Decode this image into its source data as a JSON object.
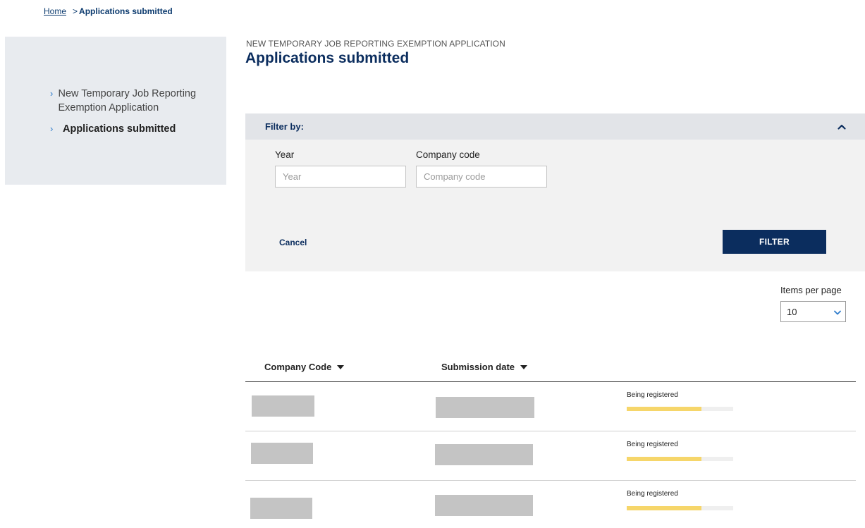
{
  "breadcrumb": {
    "home": "Home",
    "separator": ">",
    "current": "Applications submitted"
  },
  "sidebar": {
    "items": [
      {
        "label": "New Temporary Job Reporting Exemption Application",
        "chevron": "›",
        "active": false
      },
      {
        "label": "Applications submitted",
        "chevron": "›",
        "active": true
      }
    ]
  },
  "page": {
    "eyebrow": "NEW TEMPORARY JOB REPORTING EXEMPTION APPLICATION",
    "title": "Applications submitted"
  },
  "filter": {
    "title": "Filter by:",
    "toggle_icon": "chevron-up-icon",
    "fields": [
      {
        "label": "Year",
        "placeholder": "Year",
        "value": ""
      },
      {
        "label": "Company code",
        "placeholder": "Company code",
        "value": ""
      }
    ],
    "cancel_label": "Cancel",
    "submit_label": "FILTER"
  },
  "pagination": {
    "label": "Items per page",
    "value": "10"
  },
  "table": {
    "columns": [
      {
        "label": "Company Code",
        "sort_icon": "caret-down-icon"
      },
      {
        "label": "Submission date",
        "sort_icon": "caret-down-icon"
      }
    ],
    "rows": [
      {
        "company_code": "[redacted]",
        "submission_date": "[redacted]",
        "status": "Being registered",
        "progress": 0.7
      },
      {
        "company_code": "[redacted]",
        "submission_date": "[redacted]",
        "status": "Being registered",
        "progress": 0.7
      },
      {
        "company_code": "[redacted]",
        "submission_date": "[redacted]",
        "status": "Being registered",
        "progress": 0.7
      }
    ]
  },
  "colors": {
    "brand": "#0b2d5e",
    "accent": "#2f7ccc",
    "progress": "#f6d66a",
    "redaction": "#c4c4c4"
  }
}
